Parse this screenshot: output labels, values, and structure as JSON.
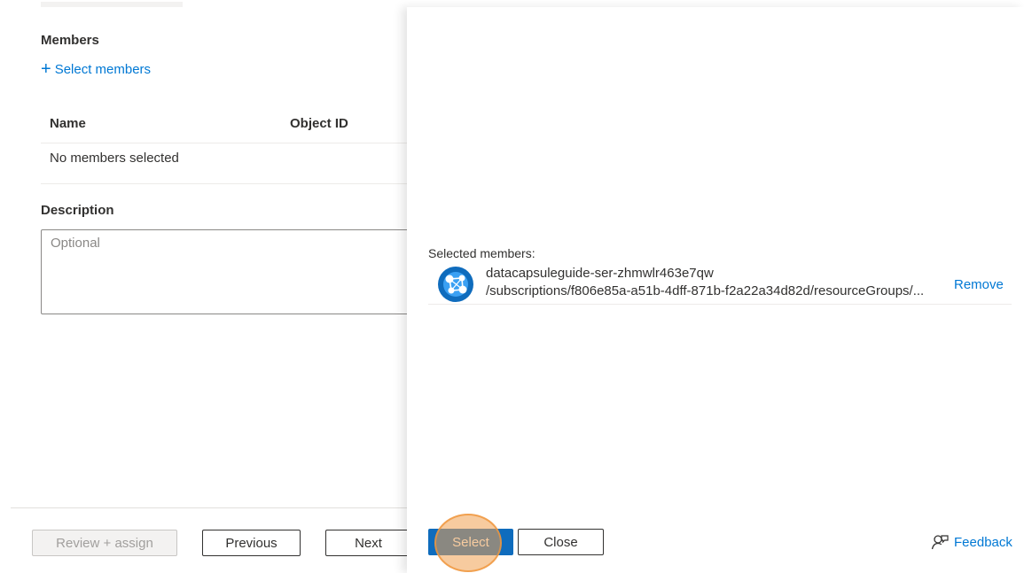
{
  "members": {
    "title": "Members",
    "add_label": "Select members",
    "columns": [
      "Name",
      "Object ID"
    ],
    "empty_text": "No members selected"
  },
  "description": {
    "title": "Description",
    "placeholder": "Optional"
  },
  "footer": {
    "review_assign": "Review + assign",
    "previous": "Previous",
    "next": "Next"
  },
  "panel": {
    "selected_label": "Selected members:",
    "selected": [
      {
        "name": "datacapsuleguide-ser-zhmwlr463e7qw",
        "path": "/subscriptions/f806e85a-a51b-4dff-871b-f2a22a34d82d/resourceGroups/...",
        "remove_label": "Remove",
        "icon": "managed-identity-icon"
      }
    ],
    "select_label": "Select",
    "close_label": "Close",
    "feedback_label": "Feedback"
  },
  "colors": {
    "accent": "#0078d4",
    "primary_button": "#0f6cbd",
    "click_highlight": "#f0a050"
  }
}
